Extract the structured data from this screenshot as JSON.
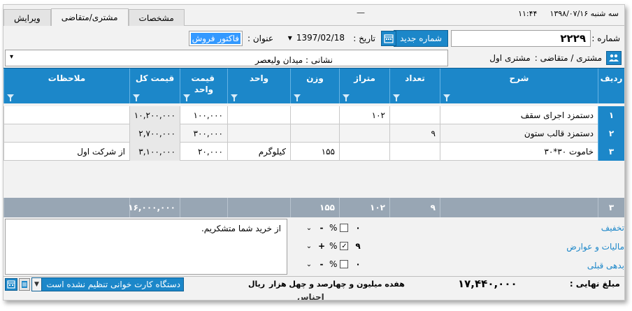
{
  "topbar": {
    "tabs": [
      "ویرایش",
      "مشتری/متقاضی",
      "مشخصات"
    ],
    "active_tab": 1,
    "minimize": "—",
    "date": "سه شنبه ۱۳۹۸/۰۷/۱۶",
    "time": "۱۱:۴۴"
  },
  "header": {
    "number_label": "شماره :",
    "number_value": "۲۲۲۹",
    "new_number_button": "شماره جدید",
    "date_label": "تاریخ :",
    "date_value": "1397/02/18",
    "title_label": "عنوان :",
    "title_value": "فاکتور فروش",
    "customer_label": "مشتری / متقاضی :",
    "customer_value": "مشتری اول",
    "address_label": "نشانی :",
    "address_value": "میدان ولیعصر"
  },
  "grid": {
    "columns": [
      "ردیف",
      "شرح",
      "تعداد",
      "متراژ",
      "وزن",
      "واحد",
      "قیمت واحد",
      "قیمت کل",
      "ملاحظات"
    ],
    "rows": [
      {
        "row": "۱",
        "desc": "دستمزد اجرای سقف",
        "count": "",
        "meter": "۱۰۲",
        "weight": "",
        "unit": "",
        "unit_price": "۱۰۰,۰۰۰",
        "total": "۱۰,۲۰۰,۰۰۰",
        "notes": ""
      },
      {
        "row": "۲",
        "desc": "دستمزد قالب ستون",
        "count": "۹",
        "meter": "",
        "weight": "",
        "unit": "",
        "unit_price": "۳۰۰,۰۰۰",
        "total": "۲,۷۰۰,۰۰۰",
        "notes": ""
      },
      {
        "row": "۳",
        "desc": "خاموت ۳۰*۳۰",
        "count": "",
        "meter": "",
        "weight": "۱۵۵",
        "unit": "کیلوگرم",
        "unit_price": "۲۰,۰۰۰",
        "total": "۳,۱۰۰,۰۰۰",
        "notes": "از شرکت اول"
      }
    ],
    "footer": {
      "row": "۳",
      "count": "۹",
      "meter": "۱۰۲",
      "weight": "۱۵۵",
      "total": "۱۶,۰۰۰,۰۰۰"
    }
  },
  "notes_text": "از خرید شما متشکریم.",
  "adjustments": [
    {
      "label": "تخفیف",
      "op": "-",
      "pct": "%",
      "checked": false,
      "value": "۰"
    },
    {
      "label": "مالیات و عوارض",
      "op": "+",
      "pct": "%",
      "checked": true,
      "value": "۹"
    },
    {
      "label": "بدهی قبلی",
      "op": "-",
      "pct": "%",
      "checked": false,
      "value": "۰"
    }
  ],
  "status": {
    "device_text": "دستگاه کارت خوانی تنظیم نشده است",
    "currency": "ریال",
    "amount_words": "هفده میلیون و چهارصد و چهل هزار",
    "final_label": "مبلغ نهایی :",
    "final_value": "۱۷,۴۴۰,۰۰۰",
    "below_text": "اجناس"
  }
}
